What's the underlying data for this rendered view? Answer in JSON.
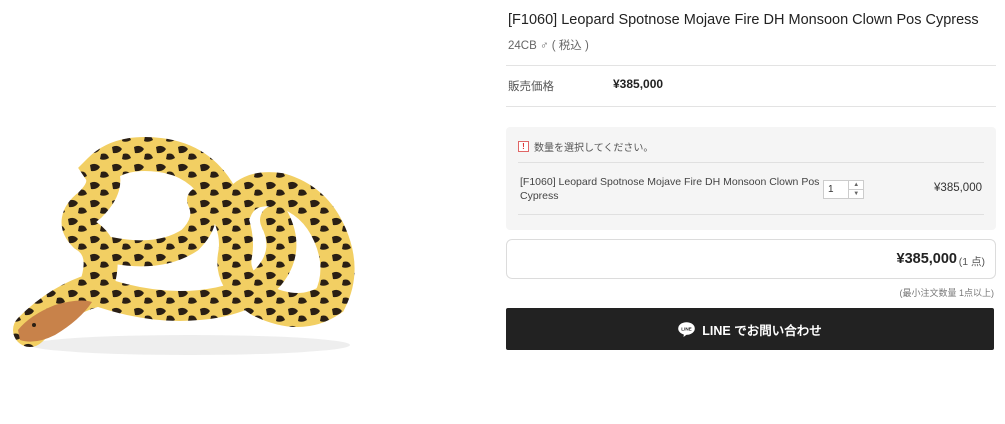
{
  "product": {
    "image_alt": "leopard spotnose ball python photo",
    "title": "[F1060] Leopard Spotnose Mojave Fire DH Monsoon Clown Pos Cypress",
    "subtitle": "24CB ♂ ( 税込 )"
  },
  "price": {
    "label": "販売価格",
    "value": "¥385,000"
  },
  "options": {
    "notice_icon": "!",
    "notice": "数量を選択してください。",
    "item_name": "[F1060] Leopard Spotnose Mojave Fire DH Monsoon Clown Pos Cypress",
    "quantity": "1",
    "item_price": "¥385,000"
  },
  "total": {
    "price": "¥385,000",
    "count": "(1 点)",
    "min_note": "(最小注文数量 1点以上)"
  },
  "line_button": {
    "label": "LINE でお問い合わせ",
    "icon": "line-chat-icon"
  },
  "colors": {
    "button_bg": "#222222",
    "option_bg": "#f5f5f5",
    "warning": "#dd3333"
  }
}
